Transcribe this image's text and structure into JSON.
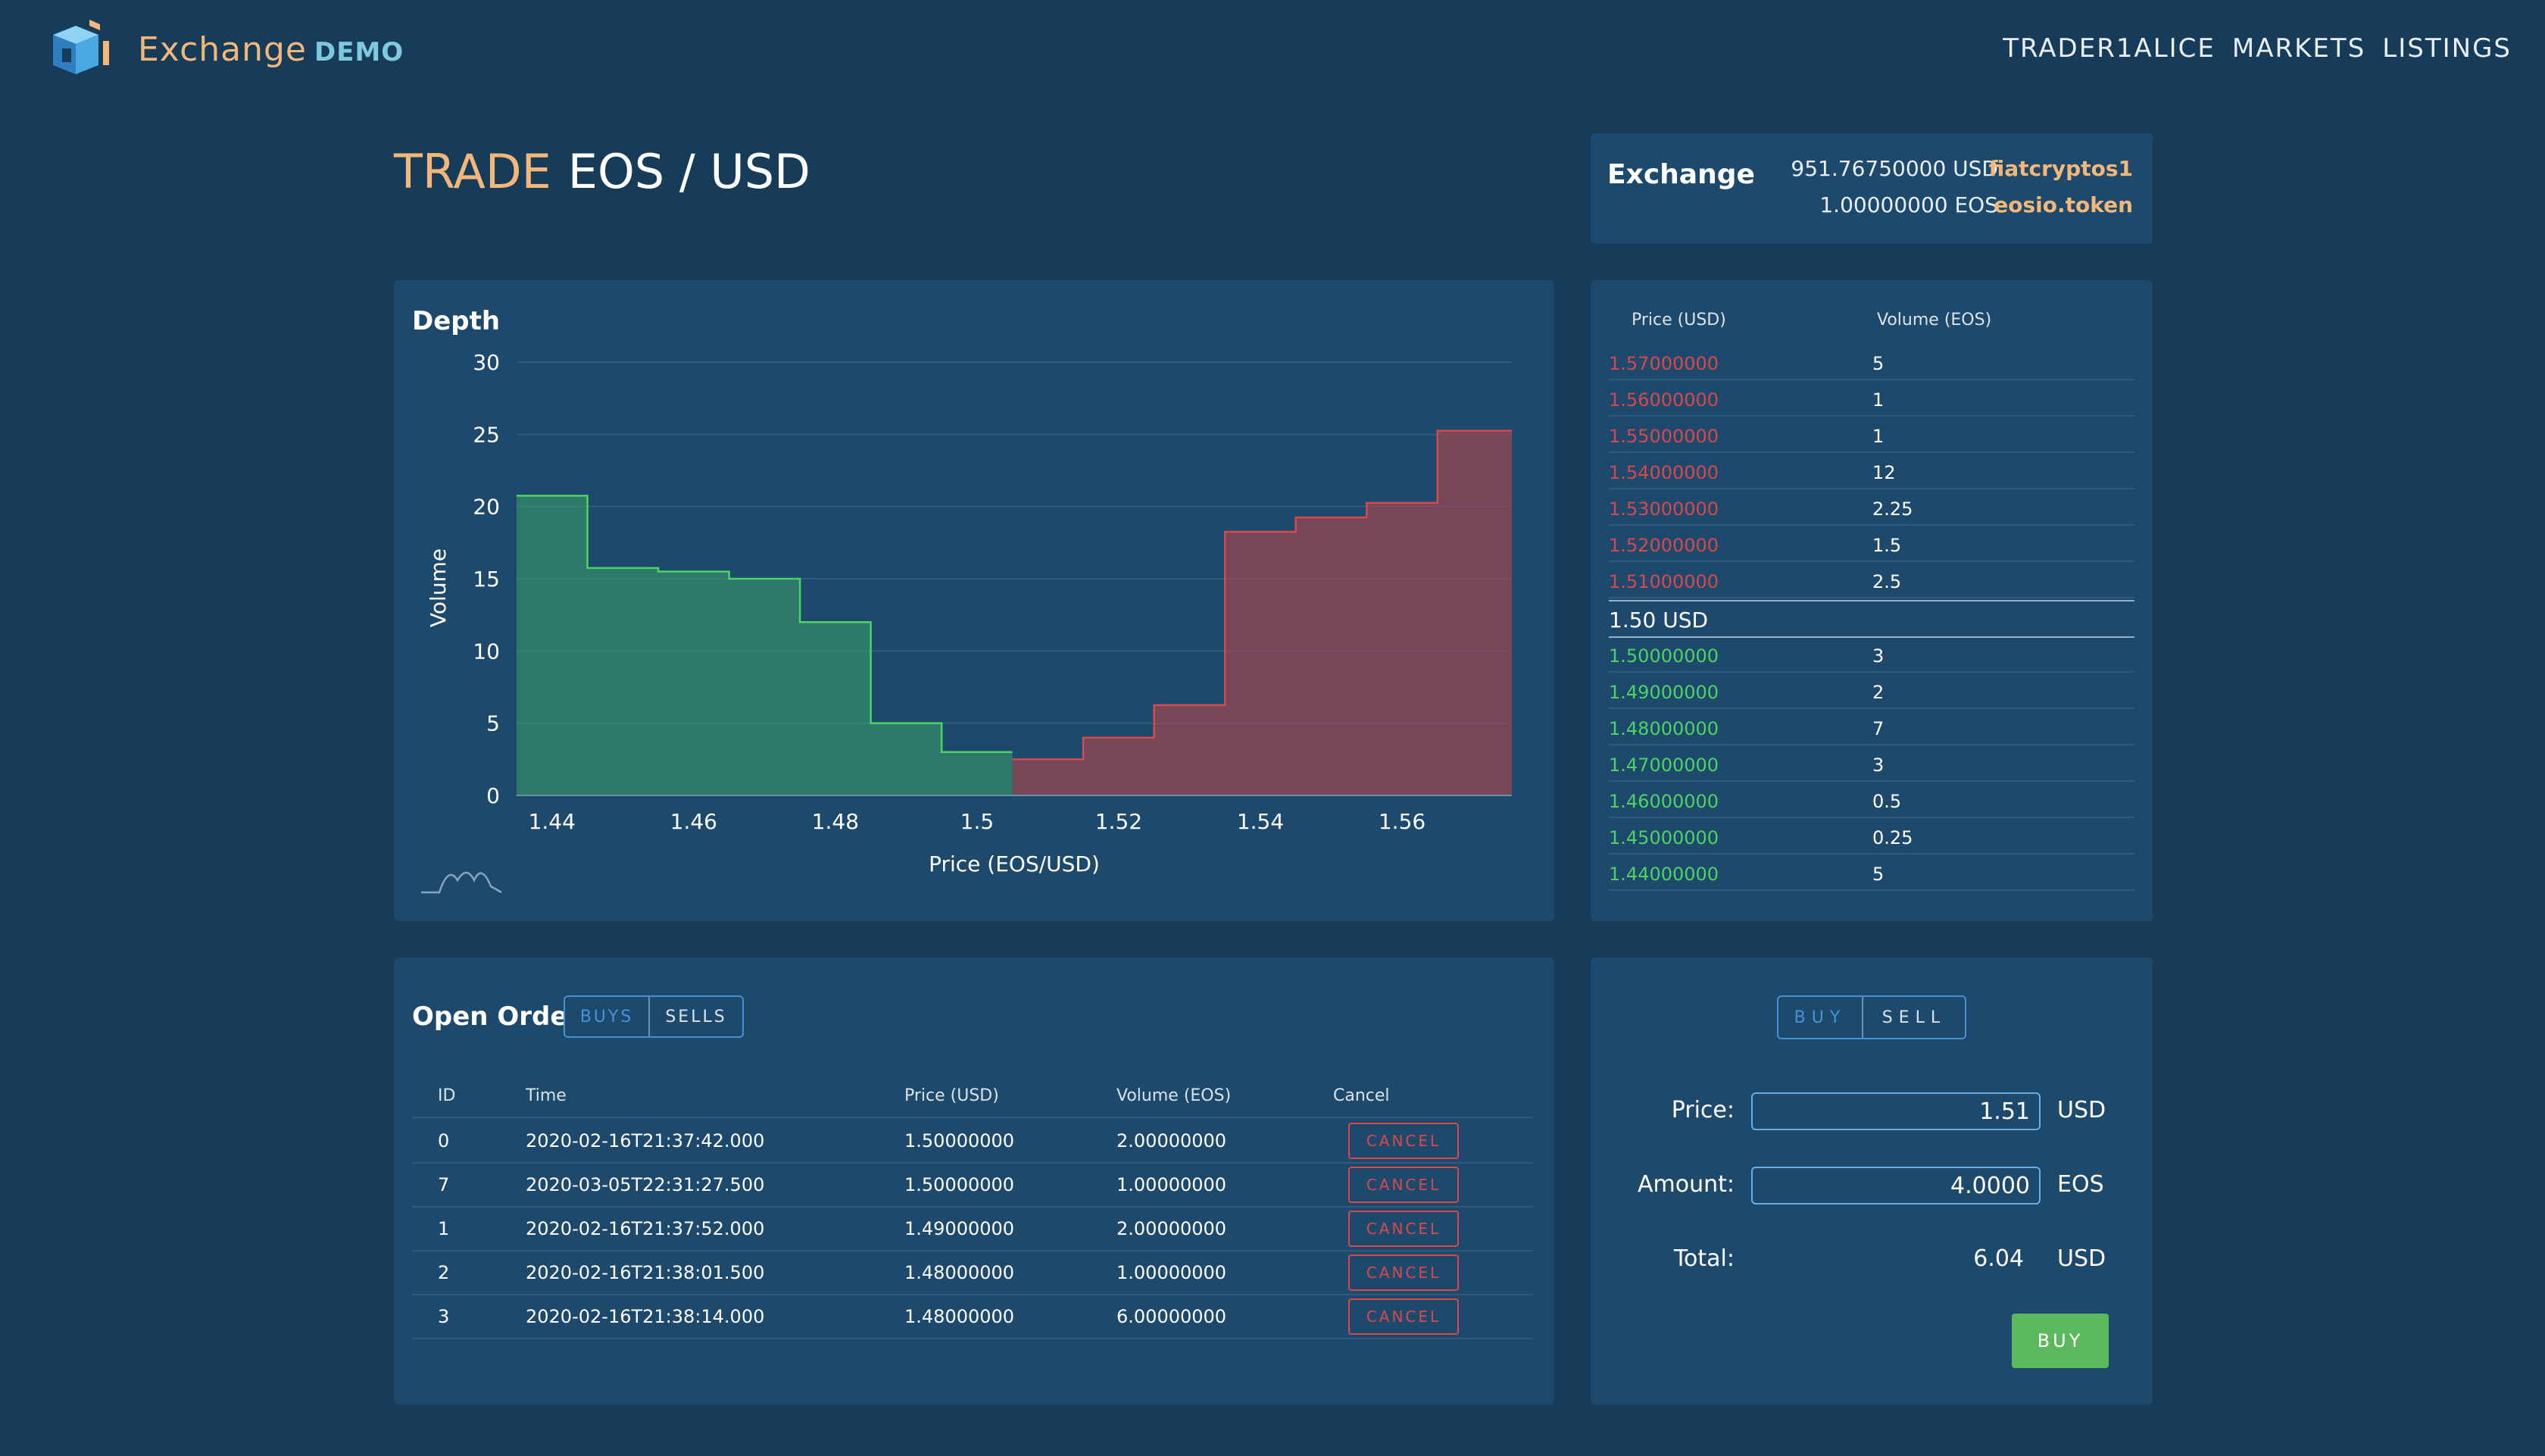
{
  "header": {
    "brand": "Exchange",
    "brand_suffix": "DEMO",
    "nav": [
      "TRADER1ALICE",
      "MARKETS",
      "LISTINGS"
    ]
  },
  "title": {
    "prefix": "TRADE",
    "pair": "EOS / USD"
  },
  "exchange": {
    "title": "Exchange",
    "balances": [
      {
        "amount": "951.76750000 USD",
        "account": "fiatcryptos1"
      },
      {
        "amount": "1.00000000 EOS",
        "account": "eosio.token"
      }
    ]
  },
  "depth": {
    "title": "Depth"
  },
  "chart_data": {
    "type": "area",
    "title": "",
    "xlabel": "Price (EOS/USD)",
    "ylabel": "Volume",
    "xlim": [
      1.435,
      1.5755
    ],
    "ylim": [
      0,
      30
    ],
    "x_ticks": [
      "1.44",
      "1.46",
      "1.48",
      "1.5",
      "1.52",
      "1.54",
      "1.56"
    ],
    "y_ticks": [
      "0",
      "5",
      "10",
      "15",
      "20",
      "25",
      "30"
    ],
    "grid": true,
    "series": [
      {
        "side": "bids",
        "color": "#3aa36a",
        "x": [
          1.435,
          1.445,
          1.455,
          1.465,
          1.475,
          1.485,
          1.495,
          1.505
        ],
        "y": [
          20.75,
          15.75,
          15.5,
          15,
          12,
          5,
          3,
          3
        ]
      },
      {
        "side": "asks",
        "color": "#c0444a",
        "x": [
          1.505,
          1.515,
          1.525,
          1.535,
          1.545,
          1.555,
          1.565,
          1.5755
        ],
        "y": [
          2.5,
          4,
          6.25,
          18.25,
          19.25,
          20.25,
          25.25,
          25.25
        ]
      }
    ]
  },
  "book": {
    "columns": [
      "Price (USD)",
      "Volume (EOS)"
    ],
    "asks": [
      {
        "price": "1.57000000",
        "volume": "5"
      },
      {
        "price": "1.56000000",
        "volume": "1"
      },
      {
        "price": "1.55000000",
        "volume": "1"
      },
      {
        "price": "1.54000000",
        "volume": "12"
      },
      {
        "price": "1.53000000",
        "volume": "2.25"
      },
      {
        "price": "1.52000000",
        "volume": "1.5"
      },
      {
        "price": "1.51000000",
        "volume": "2.5"
      }
    ],
    "mid": "1.50 USD",
    "bids": [
      {
        "price": "1.50000000",
        "volume": "3"
      },
      {
        "price": "1.49000000",
        "volume": "2"
      },
      {
        "price": "1.48000000",
        "volume": "7"
      },
      {
        "price": "1.47000000",
        "volume": "3"
      },
      {
        "price": "1.46000000",
        "volume": "0.5"
      },
      {
        "price": "1.45000000",
        "volume": "0.25"
      },
      {
        "price": "1.44000000",
        "volume": "5"
      }
    ]
  },
  "orders": {
    "title": "Open Orders",
    "tab_buys": "BUYS",
    "tab_sells": "SELLS",
    "columns": [
      "ID",
      "Time",
      "Price (USD)",
      "Volume (EOS)",
      "Cancel"
    ],
    "cancel_label": "CANCEL",
    "rows": [
      {
        "id": "0",
        "time": "2020-02-16T21:37:42.000",
        "price": "1.50000000",
        "volume": "2.00000000"
      },
      {
        "id": "7",
        "time": "2020-03-05T22:31:27.500",
        "price": "1.50000000",
        "volume": "1.00000000"
      },
      {
        "id": "1",
        "time": "2020-02-16T21:37:52.000",
        "price": "1.49000000",
        "volume": "2.00000000"
      },
      {
        "id": "2",
        "time": "2020-02-16T21:38:01.500",
        "price": "1.48000000",
        "volume": "1.00000000"
      },
      {
        "id": "3",
        "time": "2020-02-16T21:38:14.000",
        "price": "1.48000000",
        "volume": "6.00000000"
      }
    ]
  },
  "form": {
    "tab_buy": "BUY",
    "tab_sell": "SELL",
    "price_label": "Price:",
    "price_value": "1.51",
    "price_unit": "USD",
    "amount_label": "Amount:",
    "amount_value": "4.0000",
    "amount_unit": "EOS",
    "total_label": "Total:",
    "total_value": "6.04",
    "total_unit": "USD",
    "submit": "BUY"
  },
  "colors": {
    "background": "#163c5a",
    "card": "#1d4a6c",
    "accent": "#f2b779",
    "ask": "#d9484b",
    "bid": "#4cd463",
    "primary": "#4a90d9",
    "success": "#5cb85c"
  }
}
